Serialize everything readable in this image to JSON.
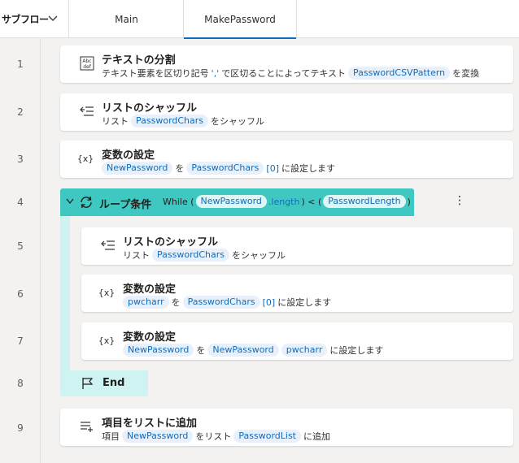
{
  "subflow": {
    "label": "サブフロー",
    "chevron_icon": "chevron-down-icon"
  },
  "tabs": [
    {
      "label": "Main",
      "active": false
    },
    {
      "label": "MakePassword",
      "active": true
    }
  ],
  "line_numbers": [
    "1",
    "2",
    "3",
    "4",
    "5",
    "6",
    "7",
    "8",
    "9"
  ],
  "actions": {
    "a1": {
      "icon": "text-split-icon",
      "icon_text": "Abc\ndef",
      "title": "テキストの分割",
      "d1": "テキスト要素を区切り記号",
      "d2": "','",
      "d3": "で区切ることによってテキスト",
      "v1": "PasswordCSVPattern",
      "d4": "を変換"
    },
    "a2": {
      "icon": "shuffle-list-icon",
      "title": "リストのシャッフル",
      "d1": "リスト",
      "v1": "PasswordChars",
      "d2": "をシャッフル"
    },
    "a3": {
      "icon": "variable-icon",
      "icon_text": "{x}",
      "title": "変数の設定",
      "v1": "NewPassword",
      "d1": "を",
      "v2": "PasswordChars",
      "idx": "[0]",
      "d2": "に設定します"
    },
    "loop": {
      "icon": "loop-icon",
      "title": "ループ条件",
      "c1": "While (",
      "v1": "NewPassword",
      "c2": ".length",
      "c3": ") < (",
      "v2": "PasswordLength",
      "c4": ")",
      "more": "⋮"
    },
    "a5": {
      "icon": "shuffle-list-icon",
      "title": "リストのシャッフル",
      "d1": "リスト",
      "v1": "PasswordChars",
      "d2": "をシャッフル"
    },
    "a6": {
      "icon": "variable-icon",
      "icon_text": "{x}",
      "title": "変数の設定",
      "v1": "pwcharr",
      "d1": "を",
      "v2": "PasswordChars",
      "idx": "[0]",
      "d2": "に設定します"
    },
    "a7": {
      "icon": "variable-icon",
      "icon_text": "{x}",
      "title": "変数の設定",
      "v1": "NewPassword",
      "d1": "を",
      "v2": "NewPassword",
      "v3": "pwcharr",
      "d2": "に設定します"
    },
    "end": {
      "icon": "flag-icon",
      "label": "End"
    },
    "a9": {
      "icon": "add-to-list-icon",
      "title": "項目をリストに追加",
      "d1": "項目",
      "v1": "NewPassword",
      "d2": "をリスト",
      "v2": "PasswordList",
      "d3": "に追加"
    }
  }
}
